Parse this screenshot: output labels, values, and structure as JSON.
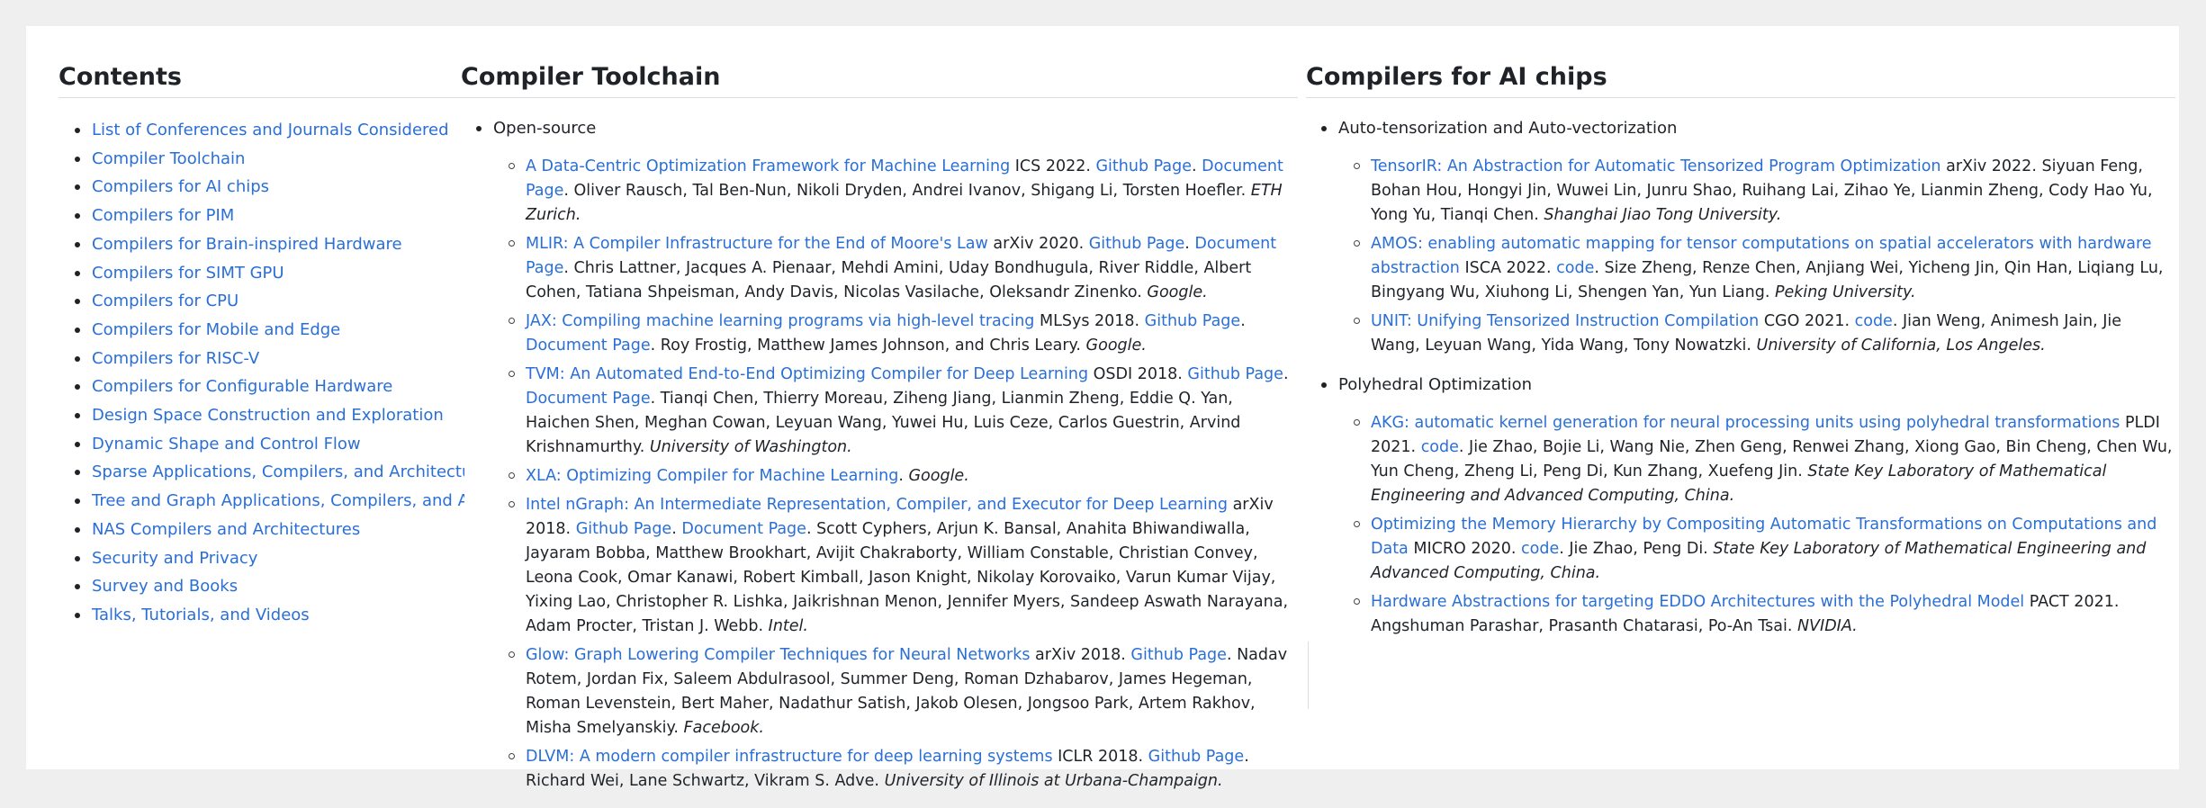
{
  "contents": {
    "title": "Contents",
    "items": [
      "List of Conferences and Journals Considered",
      "Compiler Toolchain",
      "Compilers for AI chips",
      "Compilers for PIM",
      "Compilers for Brain-inspired Hardware",
      "Compilers for SIMT GPU",
      "Compilers for CPU",
      "Compilers for Mobile and Edge",
      "Compilers for RISC-V",
      "Compilers for Configurable Hardware",
      "Design Space Construction and Exploration",
      "Dynamic Shape and Control Flow",
      "Sparse Applications, Compilers, and Architectures",
      "Tree and Graph Applications, Compilers, and Architectures",
      "NAS Compilers and Architectures",
      "Security and Privacy",
      "Survey and Books",
      "Talks, Tutorials, and Videos"
    ]
  },
  "toolchain": {
    "title": "Compiler Toolchain",
    "group": "Open-source",
    "papers": [
      {
        "title": "A Data-Centric Optimization Framework for Machine Learning",
        "venue": "ICS 2022",
        "links": [
          "Github Page",
          "Document Page"
        ],
        "authors": "Oliver Rausch, Tal Ben-Nun, Nikoli Dryden, Andrei Ivanov, Shigang Li, Torsten Hoefler.",
        "org": "ETH Zurich."
      },
      {
        "title": "MLIR: A Compiler Infrastructure for the End of Moore's Law",
        "venue": "arXiv 2020",
        "links": [
          "Github Page",
          "Document Page"
        ],
        "authors": "Chris Lattner, Jacques A. Pienaar, Mehdi Amini, Uday Bondhugula, River Riddle, Albert Cohen, Tatiana Shpeisman, Andy Davis, Nicolas Vasilache, Oleksandr Zinenko.",
        "org": "Google."
      },
      {
        "title": "JAX: Compiling machine learning programs via high-level tracing",
        "venue": "MLSys 2018",
        "links": [
          "Github Page",
          "Document Page"
        ],
        "authors": "Roy Frostig, Matthew James Johnson, and Chris Leary.",
        "org": "Google."
      },
      {
        "title": "TVM: An Automated End-to-End Optimizing Compiler for Deep Learning",
        "venue": "OSDI 2018",
        "links": [
          "Github Page",
          "Document Page"
        ],
        "authors": "Tianqi Chen, Thierry Moreau, Ziheng Jiang, Lianmin Zheng, Eddie Q. Yan, Haichen Shen, Meghan Cowan, Leyuan Wang, Yuwei Hu, Luis Ceze, Carlos Guestrin, Arvind Krishnamurthy.",
        "org": "University of Washington."
      },
      {
        "title": "XLA: Optimizing Compiler for Machine Learning",
        "venue": "",
        "links": [],
        "authors": "",
        "org": "Google."
      },
      {
        "title": "Intel nGraph: An Intermediate Representation, Compiler, and Executor for Deep Learning",
        "venue": "arXiv 2018",
        "links": [
          "Github Page",
          "Document Page"
        ],
        "authors": "Scott Cyphers, Arjun K. Bansal, Anahita Bhiwandiwalla, Jayaram Bobba, Matthew Brookhart, Avijit Chakraborty, William Constable, Christian Convey, Leona Cook, Omar Kanawi, Robert Kimball, Jason Knight, Nikolay Korovaiko, Varun Kumar Vijay, Yixing Lao, Christopher R. Lishka, Jaikrishnan Menon, Jennifer Myers, Sandeep Aswath Narayana, Adam Procter, Tristan J. Webb.",
        "org": "Intel."
      },
      {
        "title": "Glow: Graph Lowering Compiler Techniques for Neural Networks",
        "venue": "arXiv 2018",
        "links": [
          "Github Page"
        ],
        "authors": "Nadav Rotem, Jordan Fix, Saleem Abdulrasool, Summer Deng, Roman Dzhabarov, James Hegeman, Roman Levenstein, Bert Maher, Nadathur Satish, Jakob Olesen, Jongsoo Park, Artem Rakhov, Misha Smelyanskiy.",
        "org": "Facebook."
      },
      {
        "title": "DLVM: A modern compiler infrastructure for deep learning systems",
        "venue": "ICLR 2018",
        "links": [
          "Github Page"
        ],
        "authors": "Richard Wei, Lane Schwartz, Vikram S. Adve.",
        "org": "University of Illinois at Urbana-Champaign."
      }
    ]
  },
  "ai_chips": {
    "title": "Compilers for AI chips",
    "groups": [
      {
        "label": "Auto-tensorization and Auto-vectorization",
        "papers": [
          {
            "title": "TensorIR: An Abstraction for Automatic Tensorized Program Optimization",
            "venue": "arXiv 2022",
            "links": [],
            "authors": "Siyuan Feng, Bohan Hou, Hongyi Jin, Wuwei Lin, Junru Shao, Ruihang Lai, Zihao Ye, Lianmin Zheng, Cody Hao Yu, Yong Yu, Tianqi Chen.",
            "org": "Shanghai Jiao Tong University."
          },
          {
            "title": "AMOS: enabling automatic mapping for tensor computations on spatial accelerators with hardware abstraction",
            "venue": "ISCA 2022",
            "links": [
              "code"
            ],
            "authors": "Size Zheng, Renze Chen, Anjiang Wei, Yicheng Jin, Qin Han, Liqiang Lu, Bingyang Wu, Xiuhong Li, Shengen Yan, Yun Liang.",
            "org": "Peking University."
          },
          {
            "title": "UNIT: Unifying Tensorized Instruction Compilation",
            "venue": "CGO 2021",
            "links": [
              "code"
            ],
            "authors": "Jian Weng, Animesh Jain, Jie Wang, Leyuan Wang, Yida Wang, Tony Nowatzki.",
            "org": "University of California, Los Angeles."
          }
        ]
      },
      {
        "label": "Polyhedral Optimization",
        "papers": [
          {
            "title": "AKG: automatic kernel generation for neural processing units using polyhedral transformations",
            "venue": "PLDI 2021",
            "links": [
              "code"
            ],
            "authors": "Jie Zhao, Bojie Li, Wang Nie, Zhen Geng, Renwei Zhang, Xiong Gao, Bin Cheng, Chen Wu, Yun Cheng, Zheng Li, Peng Di, Kun Zhang, Xuefeng Jin.",
            "org": "State Key Laboratory of Mathematical Engineering and Advanced Computing, China."
          },
          {
            "title": "Optimizing the Memory Hierarchy by Compositing Automatic Transformations on Computations and Data",
            "venue": "MICRO 2020",
            "links": [
              "code"
            ],
            "authors": "Jie Zhao, Peng Di.",
            "org": "State Key Laboratory of Mathematical Engineering and Advanced Computing, China."
          },
          {
            "title": "Hardware Abstractions for targeting EDDO Architectures with the Polyhedral Model",
            "venue": "PACT 2021",
            "links": [],
            "authors": "Angshuman Parashar, Prasanth Chatarasi, Po-An Tsai.",
            "org": "NVIDIA."
          }
        ]
      }
    ]
  }
}
